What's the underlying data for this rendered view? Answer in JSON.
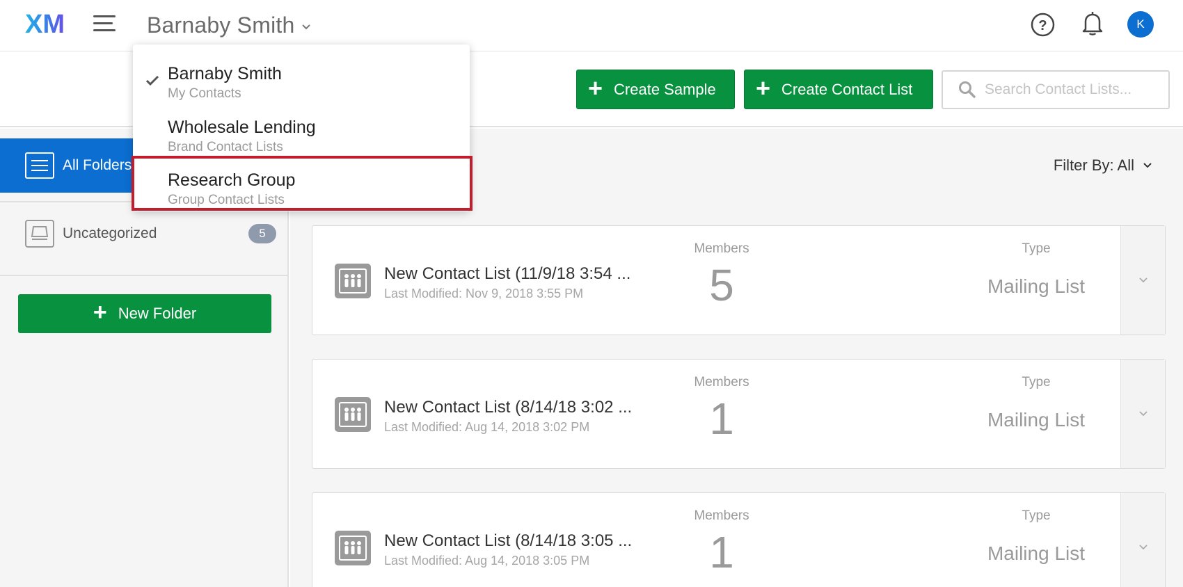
{
  "header": {
    "logo_text": "XM",
    "account_name": "Barnaby Smith",
    "avatar_initial": "K"
  },
  "actions": {
    "create_sample_label": "Create Sample",
    "create_contact_list_label": "Create Contact List",
    "search_placeholder": "Search Contact Lists..."
  },
  "sidebar": {
    "all_folders_label": "All Folders",
    "uncategorized_label": "Uncategorized",
    "uncategorized_count": "5",
    "new_folder_label": "New Folder"
  },
  "main": {
    "filter_label": "Filter By: All",
    "members_label": "Members",
    "type_label": "Type",
    "lists": [
      {
        "name": "New Contact List (11/9/18 3:54 ...",
        "modified": "Last Modified: Nov 9, 2018 3:55 PM",
        "members": "5",
        "type": "Mailing List"
      },
      {
        "name": "New Contact List (8/14/18 3:02 ...",
        "modified": "Last Modified: Aug 14, 2018 3:02 PM",
        "members": "1",
        "type": "Mailing List"
      },
      {
        "name": "New Contact List (8/14/18 3:05 ...",
        "modified": "Last Modified: Aug 14, 2018 3:05 PM",
        "members": "1",
        "type": "Mailing List"
      }
    ]
  },
  "dropdown": {
    "items": [
      {
        "title": "Barnaby Smith",
        "subtitle": "My Contacts",
        "selected": true
      },
      {
        "title": "Wholesale Lending",
        "subtitle": "Brand Contact Lists",
        "selected": false
      },
      {
        "title": "Research Group",
        "subtitle": "Group Contact Lists",
        "selected": false,
        "highlighted": true
      }
    ]
  },
  "colors": {
    "brand_green": "#08913f",
    "brand_blue": "#0b6ed0",
    "highlight_red": "#c01e2c"
  },
  "icons": [
    "menu-icon",
    "chevron-down-icon",
    "help-icon",
    "bell-icon",
    "plus-icon",
    "search-icon",
    "list-icon",
    "inbox-icon",
    "checkmark-icon",
    "contact-list-icon"
  ]
}
